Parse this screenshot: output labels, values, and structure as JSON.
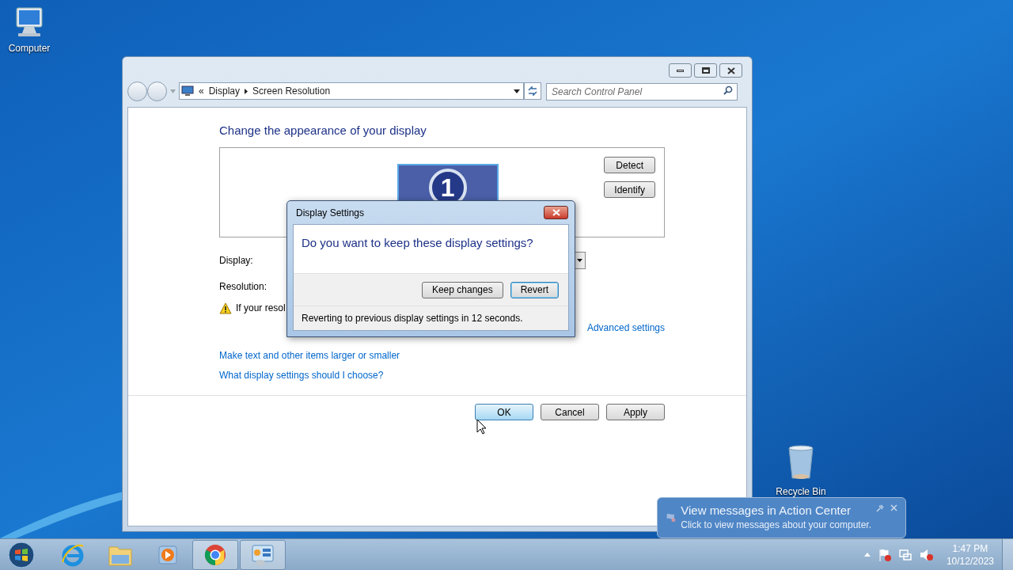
{
  "desktop_icons": [
    {
      "kind": "computer",
      "label": "Computer"
    },
    {
      "kind": "recycle",
      "label": "Recycle Bin"
    }
  ],
  "window": {
    "address": {
      "prefix": "«",
      "crumbs": [
        "Display",
        "Screen Resolution"
      ]
    },
    "search": {
      "placeholder": "Search Control Panel"
    },
    "heading": "Change the appearance of your display",
    "monitor_number": "1",
    "side_buttons": [
      "Detect",
      "Identify"
    ],
    "fields": [
      {
        "label": "Display:"
      },
      {
        "label": "Resolution:"
      }
    ],
    "warning": "If your resol",
    "advanced_link": "Advanced settings",
    "links": [
      "Make text and other items larger or smaller",
      "What display settings should I choose?"
    ],
    "buttons": [
      {
        "label": "OK",
        "default": true
      },
      {
        "label": "Cancel",
        "default": false
      },
      {
        "label": "Apply",
        "default": false
      }
    ]
  },
  "dialog": {
    "title": "Display Settings",
    "question": "Do you want to keep these display settings?",
    "buttons": [
      {
        "label": "Keep changes",
        "default": false
      },
      {
        "label": "Revert",
        "default": true
      }
    ],
    "countdown": "Reverting to previous display settings in 12 seconds."
  },
  "taskbar": {
    "apps": [
      {
        "kind": "browser-e",
        "active": false
      },
      {
        "kind": "folder",
        "active": false
      },
      {
        "kind": "media",
        "active": false
      },
      {
        "kind": "chrome",
        "active": true
      },
      {
        "kind": "control-panel",
        "active": true
      }
    ],
    "time": "1:47 PM",
    "date": "10/12/2023"
  },
  "balloon": {
    "title": "View messages in Action Center",
    "text": "Click to view messages about your computer."
  }
}
